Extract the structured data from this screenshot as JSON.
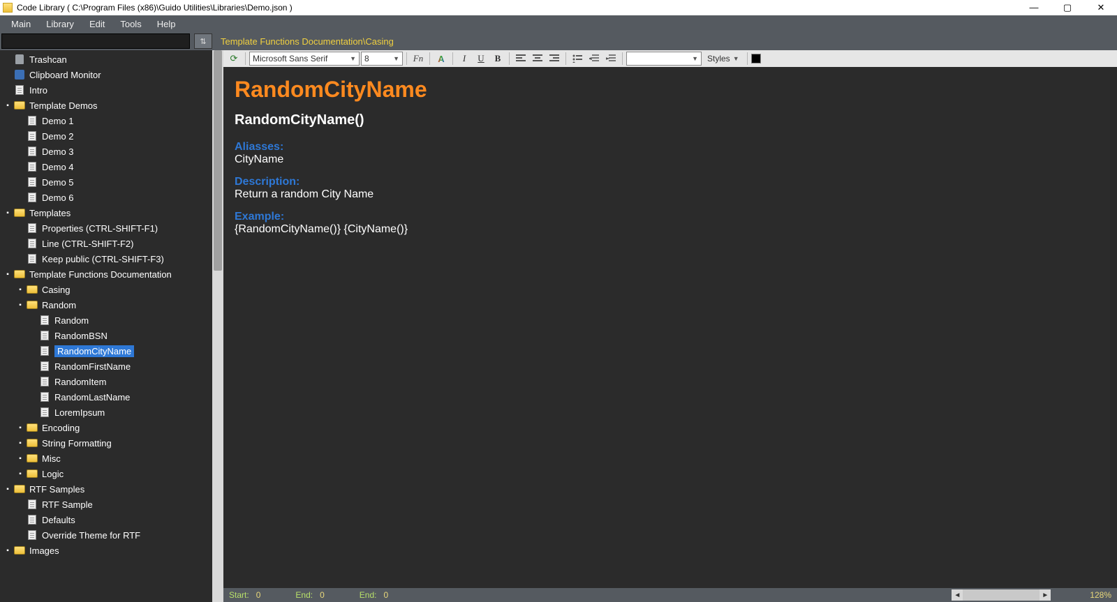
{
  "window": {
    "title": "Code Library ( C:\\Program Files (x86)\\Guido Utilities\\Libraries\\Demo.json )"
  },
  "menubar": [
    "Main",
    "Library",
    "Edit",
    "Tools",
    "Help"
  ],
  "breadcrumb": "Template Functions Documentation\\Casing",
  "editor_toolbar": {
    "font_name": "Microsoft Sans Serif",
    "font_size": "8",
    "styles_label": "Styles"
  },
  "tree": [
    {
      "level": 0,
      "toggle": "",
      "icon": "trash",
      "label": "Trashcan"
    },
    {
      "level": 0,
      "toggle": "",
      "icon": "clip",
      "label": "Clipboard Monitor"
    },
    {
      "level": 0,
      "toggle": "",
      "icon": "file",
      "label": "Intro"
    },
    {
      "level": 0,
      "toggle": "▪",
      "icon": "folder",
      "label": "Template Demos"
    },
    {
      "level": 1,
      "toggle": "",
      "icon": "file",
      "label": "Demo 1"
    },
    {
      "level": 1,
      "toggle": "",
      "icon": "file",
      "label": "Demo 2"
    },
    {
      "level": 1,
      "toggle": "",
      "icon": "file",
      "label": "Demo 3"
    },
    {
      "level": 1,
      "toggle": "",
      "icon": "file",
      "label": "Demo 4"
    },
    {
      "level": 1,
      "toggle": "",
      "icon": "file",
      "label": "Demo 5"
    },
    {
      "level": 1,
      "toggle": "",
      "icon": "file",
      "label": "Demo 6"
    },
    {
      "level": 0,
      "toggle": "▪",
      "icon": "folder",
      "label": "Templates"
    },
    {
      "level": 1,
      "toggle": "",
      "icon": "file",
      "label": "Properties (CTRL-SHIFT-F1)"
    },
    {
      "level": 1,
      "toggle": "",
      "icon": "file",
      "label": "Line (CTRL-SHIFT-F2)"
    },
    {
      "level": 1,
      "toggle": "",
      "icon": "file",
      "label": "Keep public (CTRL-SHIFT-F3)"
    },
    {
      "level": 0,
      "toggle": "▪",
      "icon": "folder",
      "label": "Template Functions Documentation"
    },
    {
      "level": 1,
      "toggle": "▪",
      "icon": "folder",
      "label": "Casing"
    },
    {
      "level": 1,
      "toggle": "▪",
      "icon": "folder",
      "label": "Random"
    },
    {
      "level": 2,
      "toggle": "",
      "icon": "file",
      "label": "Random"
    },
    {
      "level": 2,
      "toggle": "",
      "icon": "file",
      "label": "RandomBSN"
    },
    {
      "level": 2,
      "toggle": "",
      "icon": "file",
      "label": "RandomCityName",
      "selected": true
    },
    {
      "level": 2,
      "toggle": "",
      "icon": "file",
      "label": "RandomFirstName"
    },
    {
      "level": 2,
      "toggle": "",
      "icon": "file",
      "label": "RandomItem"
    },
    {
      "level": 2,
      "toggle": "",
      "icon": "file",
      "label": "RandomLastName"
    },
    {
      "level": 2,
      "toggle": "",
      "icon": "file",
      "label": "LoremIpsum"
    },
    {
      "level": 1,
      "toggle": "▪",
      "icon": "folder",
      "label": "Encoding"
    },
    {
      "level": 1,
      "toggle": "▪",
      "icon": "folder",
      "label": "String Formatting"
    },
    {
      "level": 1,
      "toggle": "▪",
      "icon": "folder",
      "label": "Misc"
    },
    {
      "level": 1,
      "toggle": "▪",
      "icon": "folder",
      "label": "Logic"
    },
    {
      "level": 0,
      "toggle": "▪",
      "icon": "folder",
      "label": "RTF Samples"
    },
    {
      "level": 1,
      "toggle": "",
      "icon": "file",
      "label": "RTF Sample"
    },
    {
      "level": 1,
      "toggle": "",
      "icon": "file",
      "label": "Defaults"
    },
    {
      "level": 1,
      "toggle": "",
      "icon": "file",
      "label": "Override Theme for RTF"
    },
    {
      "level": 0,
      "toggle": "▪",
      "icon": "folder",
      "label": "Images"
    }
  ],
  "doc": {
    "title": "RandomCityName",
    "signature": "RandomCityName()",
    "aliases_head": "Aliasses:",
    "aliases_body": "CityName",
    "description_head": "Description:",
    "description_body": "Return a random City Name",
    "example_head": "Example:",
    "example_body": "{RandomCityName()} {CityName()}"
  },
  "status": {
    "start_label": "Start:",
    "start_value": "0",
    "end1_label": "End:",
    "end1_value": "0",
    "end2_label": "End:",
    "end2_value": "0",
    "zoom": "128%"
  }
}
